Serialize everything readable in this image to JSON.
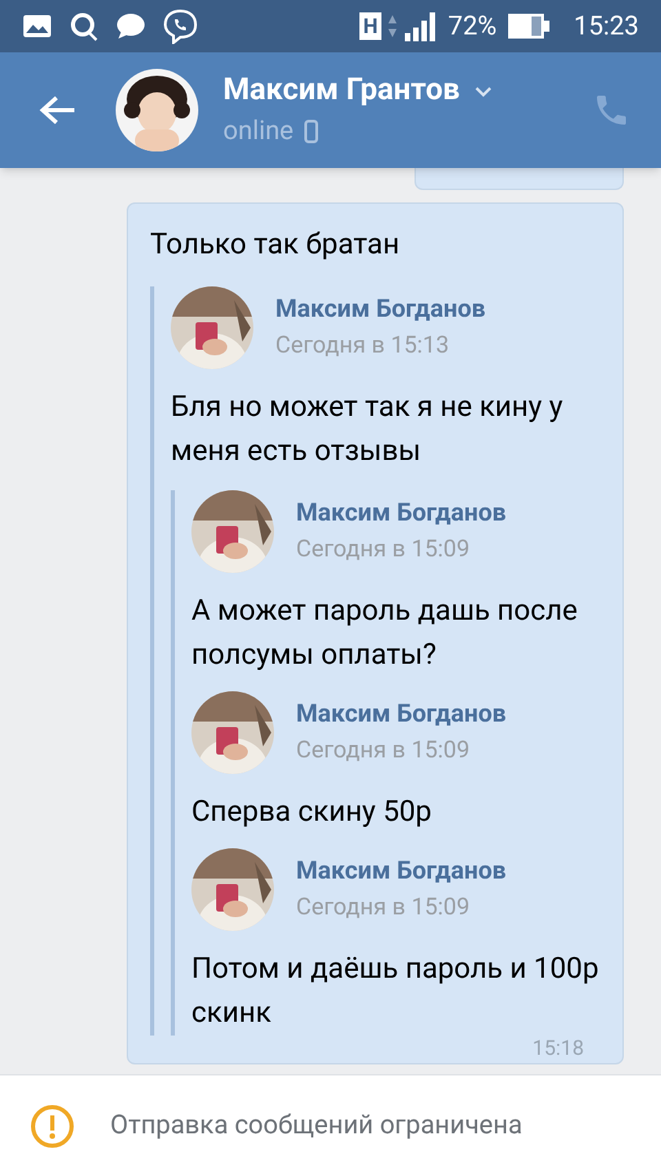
{
  "status_bar": {
    "network": "H",
    "battery": "72%",
    "time": "15:23"
  },
  "header": {
    "name": "Максим Грантов",
    "status": "online"
  },
  "message": {
    "text": "Только так братан",
    "time": "15:18",
    "forwarded": [
      {
        "author": "Максим Богданов",
        "date": "Сегодня в 15:13",
        "text": "Бля но может так я не кину у меня есть отзывы",
        "forwarded": [
          {
            "author": "Максим Богданов",
            "date": "Сегодня в 15:09",
            "text": "А может пароль дашь после полсумы оплаты?"
          },
          {
            "author": "Максим Богданов",
            "date": "Сегодня в 15:09",
            "text": "Сперва скину 50р"
          },
          {
            "author": "Максим Богданов",
            "date": "Сегодня в 15:09",
            "text": "Потом и даёшь пароль и 100р скинк"
          }
        ]
      }
    ]
  },
  "footer": {
    "notice": "Отправка сообщений ограничена"
  }
}
